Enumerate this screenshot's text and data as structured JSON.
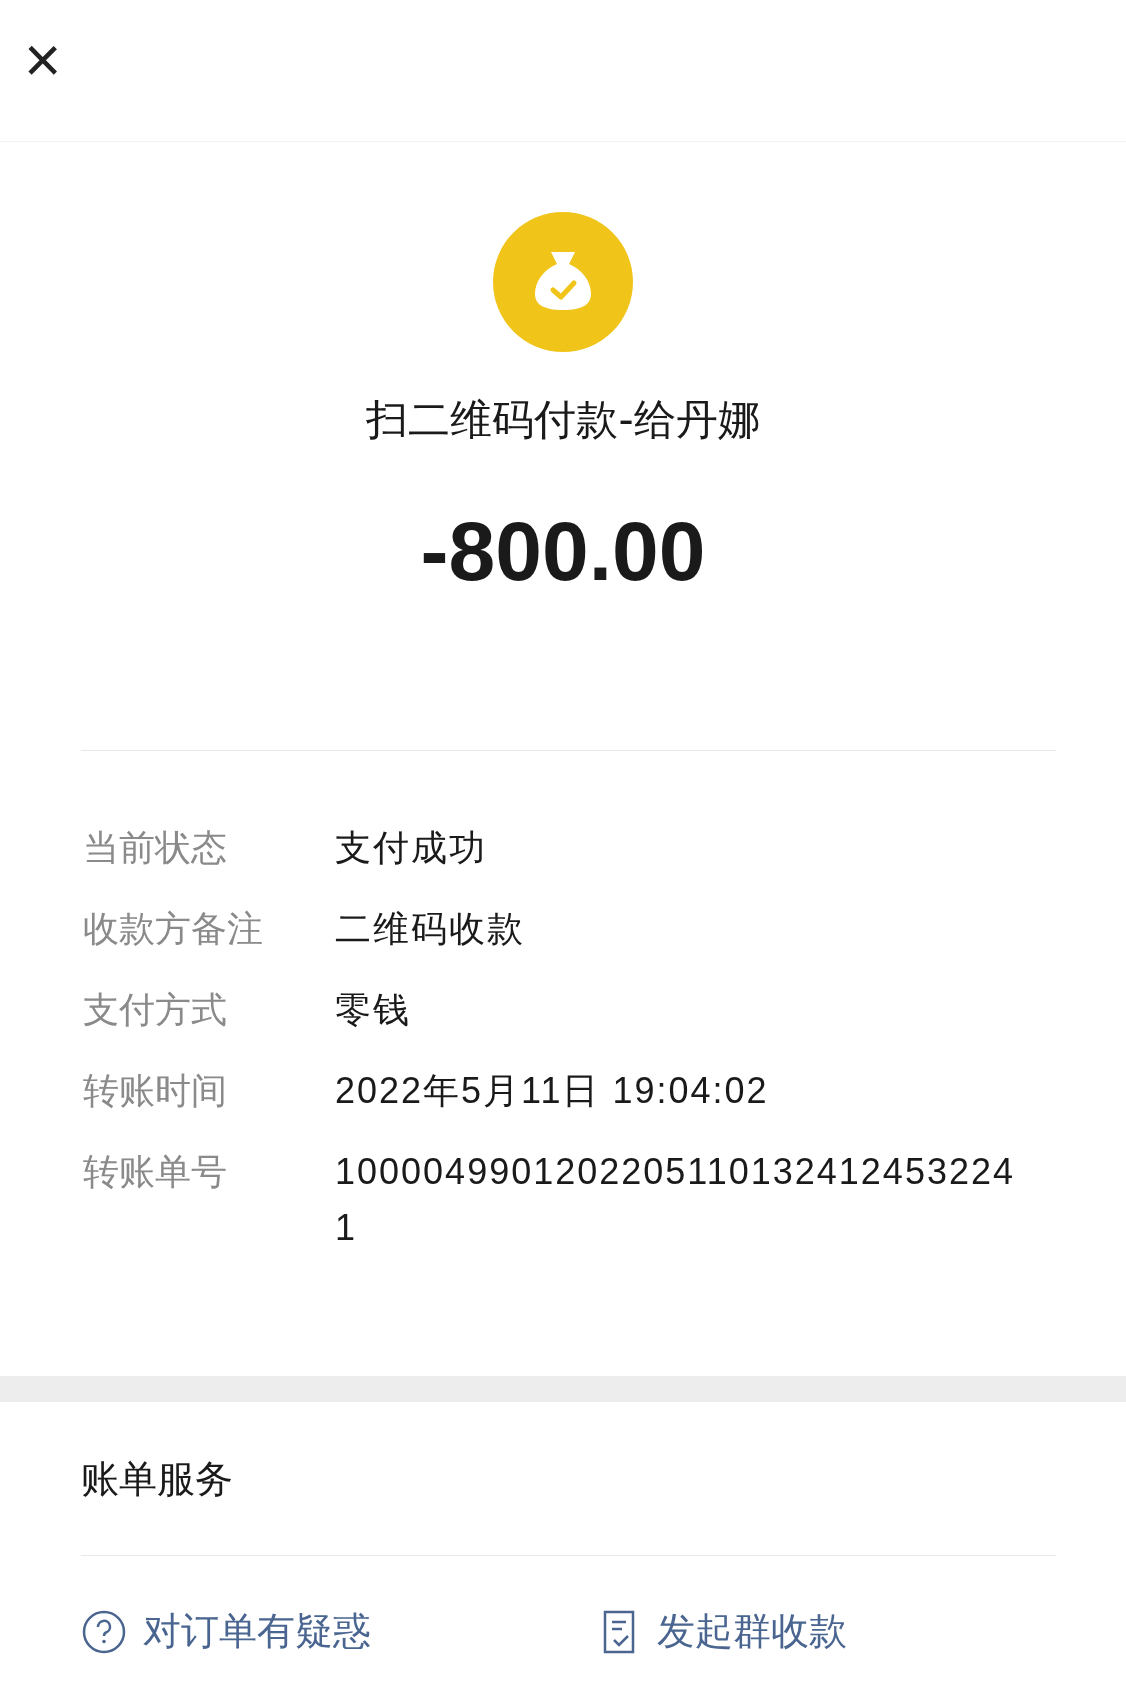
{
  "header": {
    "close": "×"
  },
  "payment": {
    "title": "扫二维码付款-给丹娜",
    "amount": "-800.00"
  },
  "details": [
    {
      "label": "当前状态",
      "value": "支付成功"
    },
    {
      "label": "收款方备注",
      "value": "二维码收款"
    },
    {
      "label": "支付方式",
      "value": "零钱"
    },
    {
      "label": "转账时间",
      "value": "2022年5月11日 19:04:02"
    },
    {
      "label": "转账单号",
      "value": "10000499012022051101324124532241"
    }
  ],
  "services": {
    "title": "账单服务",
    "actions": [
      {
        "kind": "question",
        "label": "对订单有疑惑"
      },
      {
        "kind": "group",
        "label": "发起群收款"
      }
    ]
  }
}
